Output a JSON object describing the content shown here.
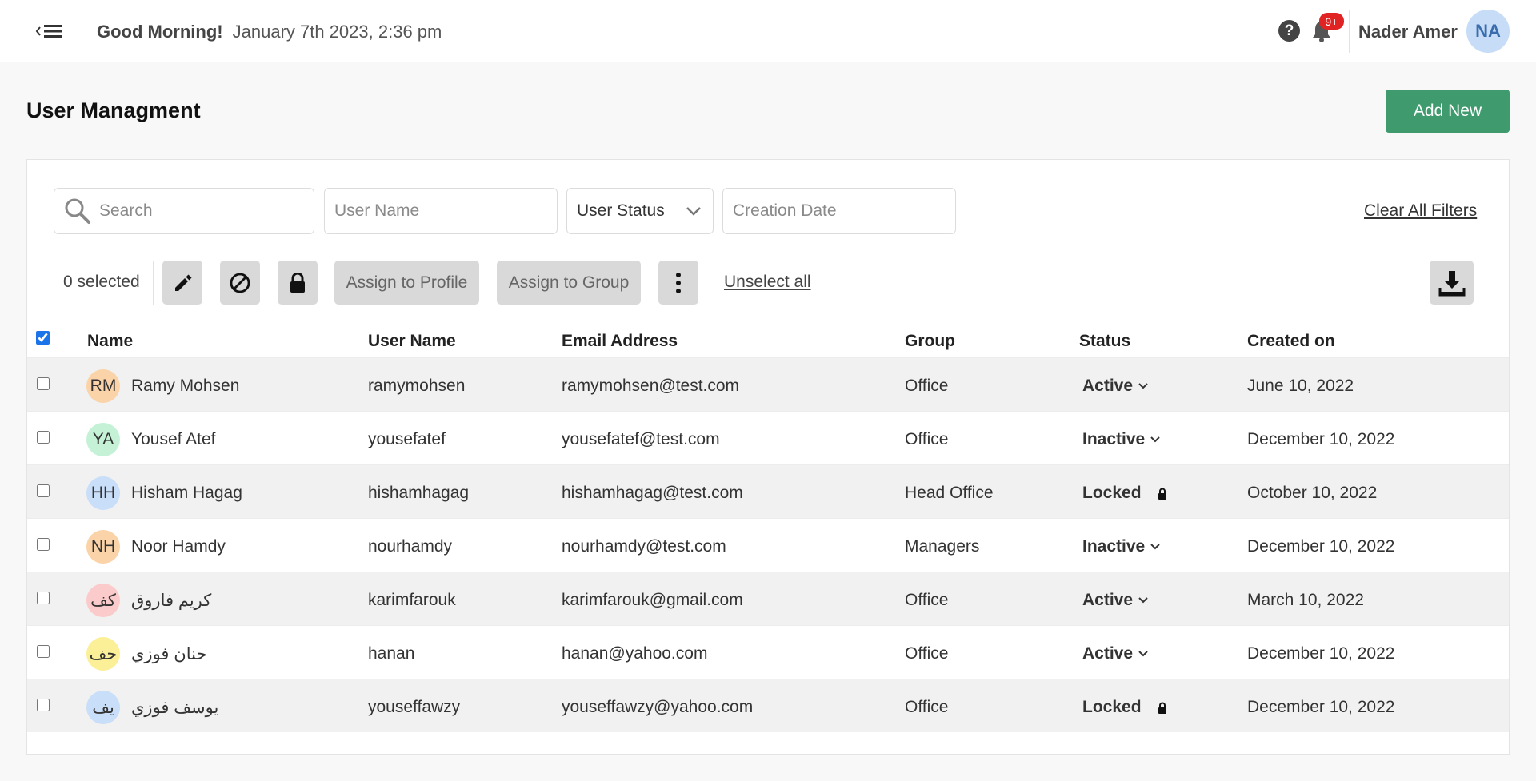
{
  "header": {
    "greeting": "Good Morning!",
    "datetime": "January 7th 2023, 2:36 pm",
    "notifications_badge": "9+",
    "user_name": "Nader Amer",
    "user_initials": "NA"
  },
  "page": {
    "title": "User Managment",
    "add_new_label": "Add New"
  },
  "filters": {
    "search_placeholder": "Search",
    "username_placeholder": "User Name",
    "status_selected": "User Status",
    "creation_date_placeholder": "Creation Date",
    "clear_all_label": "Clear All Filters"
  },
  "toolbar": {
    "selected_text": "0 selected",
    "assign_profile_label": "Assign to Profile",
    "assign_group_label": "Assign to Group",
    "unselect_all_label": "Unselect all"
  },
  "table": {
    "columns": [
      "Name",
      "User Name",
      "Email Address",
      "Group",
      "Status",
      "Created on"
    ],
    "header_checkbox_checked": true,
    "rows": [
      {
        "initials": "RM",
        "avatar_color": "#fbd3a8",
        "name": "Ramy Mohsen",
        "username": "ramymohsen",
        "email": "ramymohsen@test.com",
        "group": "Office",
        "status": "Active",
        "status_icon": "chevron-down-icon",
        "created": "June 10, 2022"
      },
      {
        "initials": "YA",
        "avatar_color": "#c5f2d6",
        "name": "Yousef Atef",
        "username": "yousefatef",
        "email": "yousefatef@test.com",
        "group": "Office",
        "status": "Inactive",
        "status_icon": "chevron-down-icon",
        "created": "December 10, 2022"
      },
      {
        "initials": "HH",
        "avatar_color": "#c9def8",
        "name": "Hisham Hagag",
        "username": "hishamhagag",
        "email": "hishamhagag@test.com",
        "group": "Head Office",
        "status": "Locked",
        "status_icon": "lock-icon",
        "created": "October 10, 2022"
      },
      {
        "initials": "NH",
        "avatar_color": "#fbd3a8",
        "name": "Noor Hamdy",
        "username": "nourhamdy",
        "email": "nourhamdy@test.com",
        "group": "Managers",
        "status": "Inactive",
        "status_icon": "chevron-down-icon",
        "created": "December 10, 2022"
      },
      {
        "initials": "كف",
        "avatar_color": "#fbcaca",
        "name": "كريم فاروق",
        "username": "karimfarouk",
        "email": "karimfarouk@gmail.com",
        "group": "Office",
        "status": "Active",
        "status_icon": "chevron-down-icon",
        "created": "March 10, 2022"
      },
      {
        "initials": "حف",
        "avatar_color": "#fbef97",
        "name": "حنان فوزي",
        "username": "hanan",
        "email": "hanan@yahoo.com",
        "group": "Office",
        "status": "Active",
        "status_icon": "chevron-down-icon",
        "created": "December 10, 2022"
      },
      {
        "initials": "يف",
        "avatar_color": "#c9def8",
        "name": "يوسف فوزي",
        "username": "youseffawzy",
        "email": "youseffawzy@yahoo.com",
        "group": "Office",
        "status": "Locked",
        "status_icon": "lock-icon",
        "created": "December 10, 2022"
      }
    ]
  },
  "colors": {
    "accent_green": "#3f9b6e",
    "badge_red": "#e02424",
    "avatar_blue": "#c7dcf7"
  }
}
